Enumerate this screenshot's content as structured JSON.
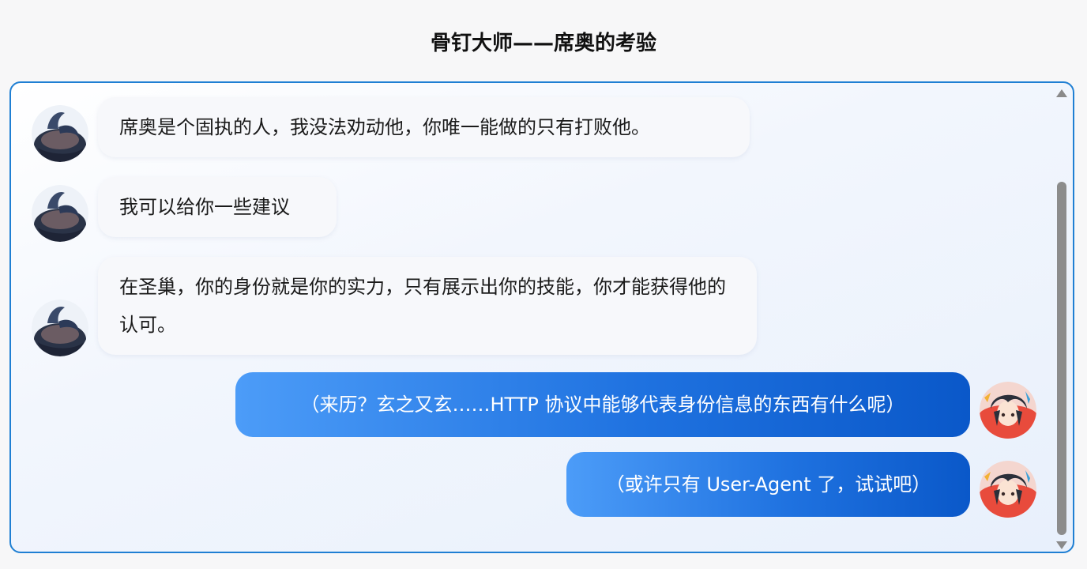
{
  "page": {
    "title": "骨钉大师——席奥的考验"
  },
  "messages": [
    {
      "role": "bot",
      "avatar": "sheo-avatar-icon",
      "text": "席奥是个固执的人，我没法劝动他，你唯一能做的只有打败他。"
    },
    {
      "role": "bot",
      "avatar": "sheo-avatar-icon",
      "text": "我可以给你一些建议"
    },
    {
      "role": "bot",
      "avatar": "sheo-avatar-icon",
      "text": "在圣巢，你的身份就是你的实力，只有展示出你的技能，你才能获得他的认可。"
    },
    {
      "role": "user",
      "avatar": "anime-user-avatar-icon",
      "text": "（来历？玄之又玄……HTTP 协议中能够代表身份信息的东西有什么呢）"
    },
    {
      "role": "user",
      "avatar": "anime-user-avatar-icon",
      "text": "（或许只有 User-Agent 了，试试吧）"
    }
  ],
  "colors": {
    "chat_border": "#1f7fd3",
    "user_bubble_start": "#4c9cf8",
    "user_bubble_end": "#0a58c9",
    "bot_bubble": "#f7f8fb"
  }
}
